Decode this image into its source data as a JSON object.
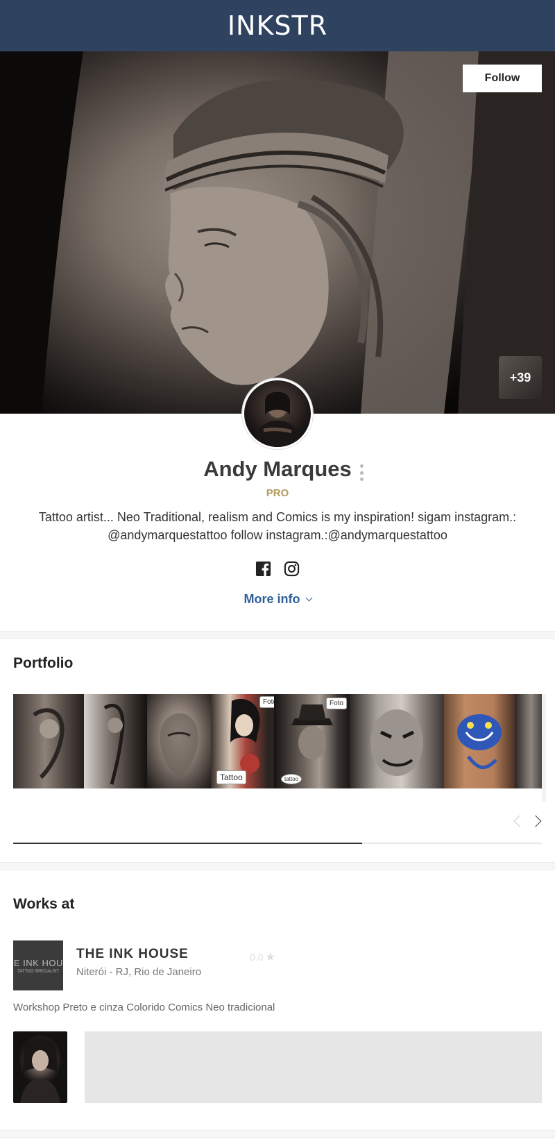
{
  "header": {
    "logo": "INKSTR"
  },
  "hero": {
    "follow_label": "Follow",
    "more_photos_label": "+39"
  },
  "profile": {
    "name": "Andy Marques",
    "badge": "PRO",
    "bio": "Tattoo artist... Neo Traditional, realism and Comics is my inspiration! sigam instagram.: @andymarquestattoo follow instagram.:@andymarquestattoo",
    "socials": [
      "facebook-icon",
      "instagram-icon"
    ],
    "more_info_label": "More info"
  },
  "portfolio": {
    "title": "Portfolio",
    "tiles": [
      {
        "tag": ""
      },
      {
        "tag": ""
      },
      {
        "tag": ""
      },
      {
        "tag": "Tattoo",
        "tag2": "Foto"
      },
      {
        "tag": "tattoo",
        "tag2": "Foto"
      },
      {
        "tag": ""
      },
      {
        "tag": ""
      },
      {
        "tag": ""
      }
    ],
    "scroll_progress": 0.66
  },
  "works_at": {
    "title": "Works at",
    "shop": {
      "logo_text": "HE INK HOUS",
      "logo_sub": "TATTOO SPECIALIST",
      "name": "THE INK HOUSE",
      "rating": "0.0",
      "location": "Niterói - RJ, Rio de Janeiro",
      "tags": "Workshop Preto e cinza Colorido Comics Neo tradicional"
    }
  }
}
